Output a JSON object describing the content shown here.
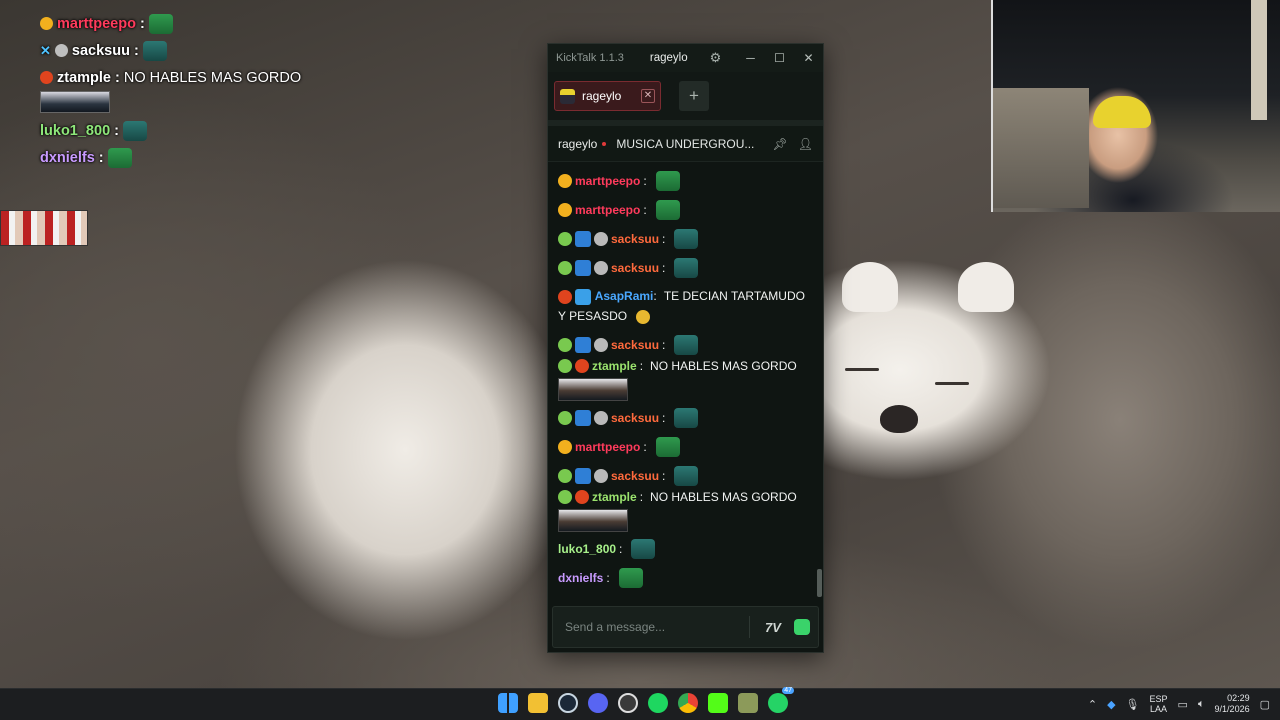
{
  "overlay_chat": [
    {
      "user": "marttpeepo",
      "color": "#ff3b5c",
      "text": "",
      "emote": "green"
    },
    {
      "user": "sacksuu",
      "color": "#ffffff",
      "text": "",
      "emote": "teal"
    },
    {
      "user": "ztample",
      "color": "#ffffff",
      "text": "NO HABLES MAS GORDO",
      "emote": ""
    },
    {
      "user": "luko1_800",
      "color": "#8ee77a",
      "text": "",
      "emote": "teal"
    },
    {
      "user": "dxnielfs",
      "color": "#c99bff",
      "text": "",
      "emote": "green"
    }
  ],
  "kicktalk": {
    "app_title": "KickTalk 1.1.3",
    "channel": "rageylo",
    "tab_label": "rageylo",
    "add_tab": "+",
    "stream_title": "MUSICA UNDERGROU...",
    "input_placeholder": "Send a message...",
    "messages": [
      {
        "user": "marttpeepo",
        "color": "#ff3b5c",
        "text": "",
        "badges": [
          "gold"
        ],
        "emote": "green"
      },
      {
        "user": "marttpeepo",
        "color": "#ff3b5c",
        "text": "",
        "badges": [
          "gold"
        ],
        "emote": "green"
      },
      {
        "user": "sacksuu",
        "color": "#ff6a3d",
        "text": "",
        "badges": [
          "alien",
          "blue",
          "gray"
        ],
        "emote": "teal"
      },
      {
        "user": "sacksuu",
        "color": "#ff6a3d",
        "text": "",
        "badges": [
          "alien",
          "blue",
          "gray"
        ],
        "emote": "teal"
      },
      {
        "user": "AsapRami",
        "color": "#4aa8ff",
        "text": "TE DECIAN TARTAMUDO Y PESASDO",
        "badges": [
          "red",
          "cube"
        ],
        "emote": ""
      },
      {
        "user": "sacksuu",
        "color": "#ff6a3d",
        "text": "",
        "badges": [
          "alien",
          "blue",
          "gray"
        ],
        "emote": "teal"
      },
      {
        "user": "ztample",
        "color": "#9be36e",
        "text": "NO HABLES MAS GORDO",
        "badges": [
          "alien",
          "red"
        ],
        "emote": ""
      },
      {
        "user": "sacksuu",
        "color": "#ff6a3d",
        "text": "",
        "badges": [
          "alien",
          "blue",
          "gray"
        ],
        "emote": "teal"
      },
      {
        "user": "marttpeepo",
        "color": "#ff3b5c",
        "text": "",
        "badges": [
          "gold"
        ],
        "emote": "green"
      },
      {
        "user": "sacksuu",
        "color": "#ff6a3d",
        "text": "",
        "badges": [
          "alien",
          "blue",
          "gray"
        ],
        "emote": "teal"
      },
      {
        "user": "ztample",
        "color": "#9be36e",
        "text": "NO HABLES MAS GORDO",
        "badges": [
          "alien",
          "red"
        ],
        "emote": ""
      },
      {
        "user": "luko1_800",
        "color": "#a7f08a",
        "text": "",
        "badges": [],
        "emote": "teal"
      },
      {
        "user": "dxnielfs",
        "color": "#c99bff",
        "text": "",
        "badges": [],
        "emote": "green"
      }
    ]
  },
  "taskbar": {
    "apps": [
      "windows-start",
      "file-explorer",
      "steam",
      "discord",
      "obs",
      "spotify",
      "chrome",
      "kick",
      "notes",
      "whatsapp"
    ],
    "whatsapp_badge": "47",
    "lang_top": "ESP",
    "lang_bottom": "LAA",
    "time": "02:29",
    "date": "9/1/2026"
  },
  "colors": {
    "kick_green": "#53fc18",
    "window_bg": "#0f1512",
    "tab_active": "#3a1a1c"
  }
}
